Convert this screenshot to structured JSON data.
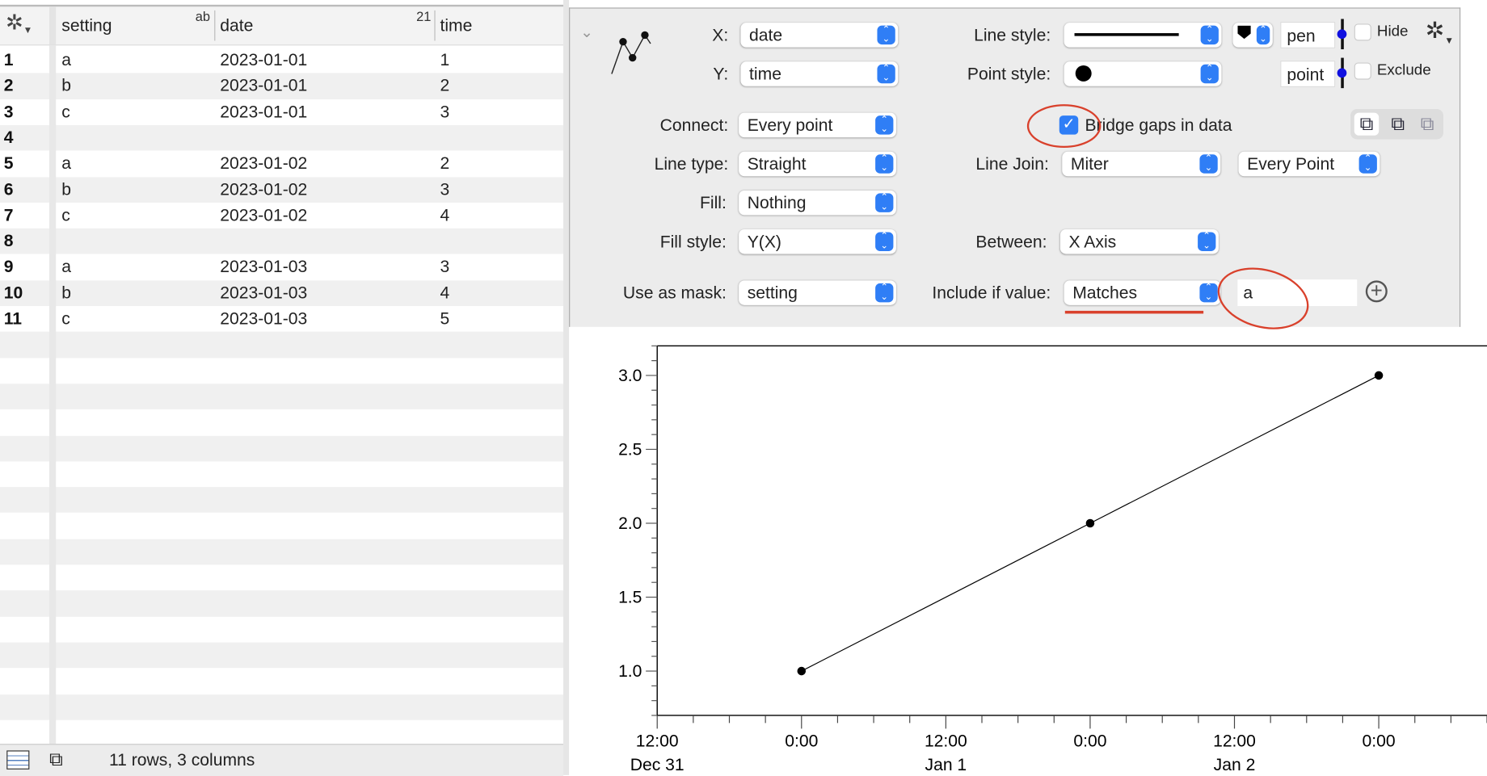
{
  "table": {
    "columns": [
      {
        "name": "setting",
        "type_badge": "ab"
      },
      {
        "name": "date",
        "type_badge": "21"
      },
      {
        "name": "time",
        "type_badge": ""
      }
    ],
    "rows": [
      {
        "n": "1",
        "setting": "a",
        "date": "2023-01-01",
        "time": "1"
      },
      {
        "n": "2",
        "setting": "b",
        "date": "2023-01-01",
        "time": "2"
      },
      {
        "n": "3",
        "setting": "c",
        "date": "2023-01-01",
        "time": "3"
      },
      {
        "n": "4",
        "setting": "",
        "date": "",
        "time": ""
      },
      {
        "n": "5",
        "setting": "a",
        "date": "2023-01-02",
        "time": "2"
      },
      {
        "n": "6",
        "setting": "b",
        "date": "2023-01-02",
        "time": "3"
      },
      {
        "n": "7",
        "setting": "c",
        "date": "2023-01-02",
        "time": "4"
      },
      {
        "n": "8",
        "setting": "",
        "date": "",
        "time": ""
      },
      {
        "n": "9",
        "setting": "a",
        "date": "2023-01-03",
        "time": "3"
      },
      {
        "n": "10",
        "setting": "b",
        "date": "2023-01-03",
        "time": "4"
      },
      {
        "n": "11",
        "setting": "c",
        "date": "2023-01-03",
        "time": "5"
      }
    ],
    "status": "11 rows, 3 columns"
  },
  "panel": {
    "x_label": "X:",
    "x_value": "date",
    "y_label": "Y:",
    "y_value": "time",
    "line_style_label": "Line style:",
    "point_style_label": "Point style:",
    "pen_field": "pen",
    "point_field": "point",
    "hide_label": "Hide",
    "hide_checked": false,
    "exclude_label": "Exclude",
    "exclude_checked": false,
    "connect_label": "Connect:",
    "connect_value": "Every point",
    "bridge_label": "Bridge gaps in data",
    "bridge_checked": true,
    "line_type_label": "Line type:",
    "line_type_value": "Straight",
    "line_join_label": "Line Join:",
    "line_join_value": "Miter",
    "join_points_value": "Every Point",
    "fill_label": "Fill:",
    "fill_value": "Nothing",
    "fill_style_label": "Fill style:",
    "fill_style_value": "Y(X)",
    "between_label": "Between:",
    "between_value": "X Axis",
    "mask_label": "Use as mask:",
    "mask_value": "setting",
    "include_label": "Include if value:",
    "include_value": "Matches",
    "match_field": "a",
    "accent": "#2f7ef6",
    "annotation_color": "#d9412c"
  },
  "chart_data": {
    "type": "line",
    "x": [
      "2023-01-01 00:00",
      "2023-01-02 00:00",
      "2023-01-03 00:00"
    ],
    "y": [
      1,
      2,
      3
    ],
    "xlim": [
      "2022-12-31 12:00",
      "2023-01-03 09:00"
    ],
    "ylim": [
      0.7,
      3.2
    ],
    "y_ticks": [
      "1.0",
      "1.5",
      "2.0",
      "2.5",
      "3.0"
    ],
    "x_ticks": [
      {
        "time": "12:00",
        "date": "Dec 31"
      },
      {
        "time": "0:00",
        "date": ""
      },
      {
        "time": "12:00",
        "date": "Jan 1"
      },
      {
        "time": "0:00",
        "date": ""
      },
      {
        "time": "12:00",
        "date": "Jan 2"
      },
      {
        "time": "0:00",
        "date": ""
      }
    ],
    "grid": false,
    "line_color": "#000000",
    "marker": "filled-circle"
  }
}
